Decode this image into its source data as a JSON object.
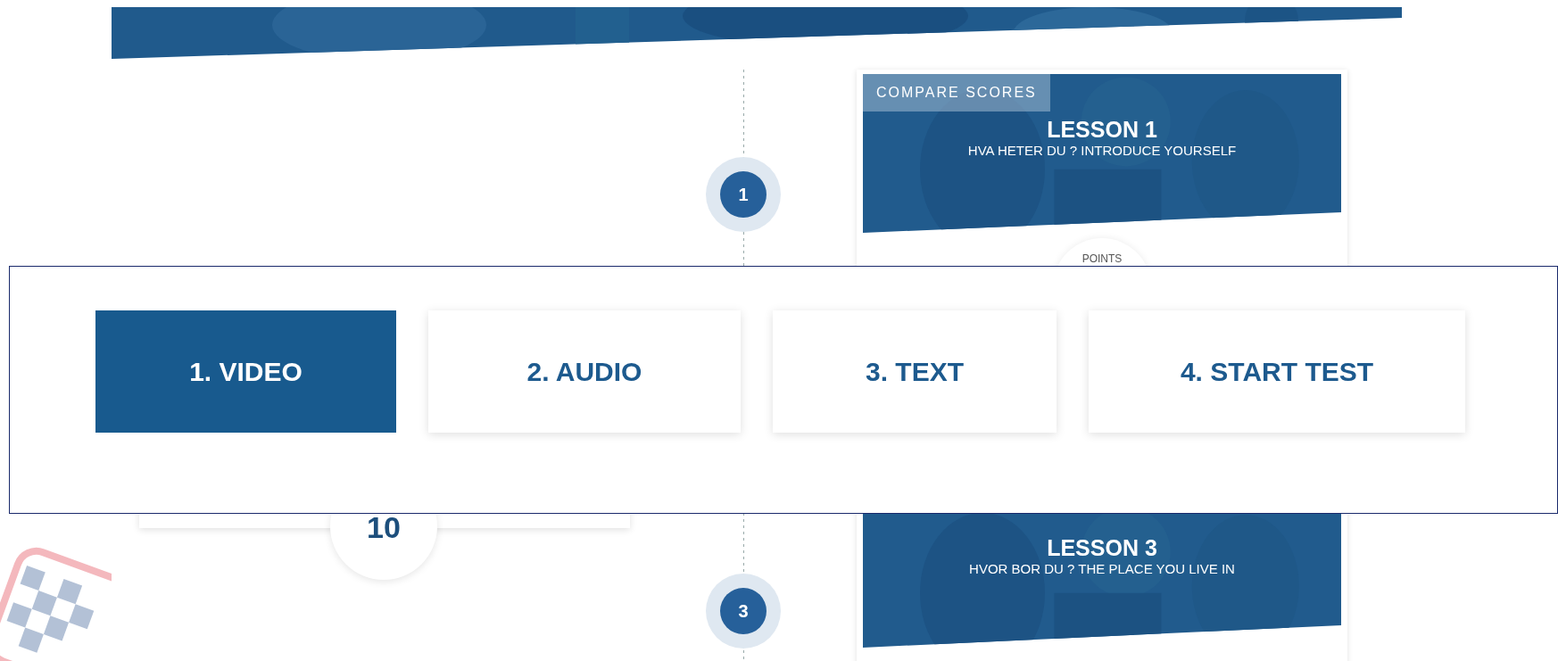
{
  "lessons": [
    {
      "tag": "COMPARE SCORES",
      "title": "LESSON 1",
      "subtitle": "HVA HETER DU ? INTRODUCE YOURSELF",
      "points_label": "POINTS"
    },
    {
      "title": "LESSON 3",
      "subtitle": "HVOR BOR DU ? THE PLACE YOU LIVE IN"
    }
  ],
  "timeline": [
    {
      "label": "1"
    },
    {
      "label": "3"
    }
  ],
  "score_card": {
    "value": "10"
  },
  "steps": [
    {
      "label": "1. VIDEO",
      "selected": true
    },
    {
      "label": "2. AUDIO",
      "selected": false
    },
    {
      "label": "3. TEXT",
      "selected": false
    },
    {
      "label": "4. START TEST",
      "selected": false
    }
  ]
}
